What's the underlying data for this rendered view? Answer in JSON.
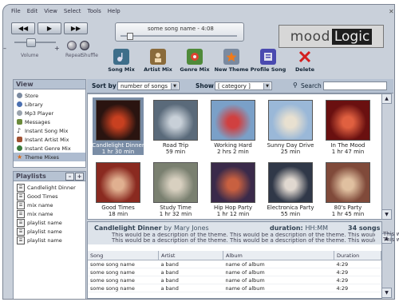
{
  "menu": [
    "File",
    "Edit",
    "View",
    "Select",
    "Tools",
    "Help"
  ],
  "transport": {
    "rewind": "◀◀",
    "play": "▶",
    "forward": "▶▶"
  },
  "volume": {
    "minus": "–",
    "plus": "+",
    "label": "Volume",
    "level": 0.35
  },
  "toggles": {
    "repeat": "Repeat",
    "shuffle": "Shuffle"
  },
  "now_playing": {
    "song": "some song name - 4:08"
  },
  "logo": {
    "part1": "mood",
    "part2": "Logic"
  },
  "toolbar": [
    {
      "label": "Song Mix",
      "icon": "song-mix-icon",
      "color": "#3e6e8a"
    },
    {
      "label": "Artist Mix",
      "icon": "artist-mix-icon",
      "color": "#8a6b3b"
    },
    {
      "label": "Genre Mix",
      "icon": "genre-mix-icon",
      "color": "#4f8a3a"
    },
    {
      "label": "New Theme",
      "icon": "star-icon",
      "color": "#d96a1a"
    },
    {
      "label": "Profile Song",
      "icon": "profile-song-icon",
      "color": "#4a4ab0"
    },
    {
      "label": "Delete",
      "icon": "delete-icon",
      "color": "#d41e1e"
    }
  ],
  "sort": {
    "label": "Sort by",
    "value": "number of songs"
  },
  "show": {
    "label": "Show",
    "value": "category"
  },
  "search": {
    "label": "Search",
    "value": ""
  },
  "view": {
    "title": "View",
    "items": [
      {
        "label": "Store",
        "color": "#7b8aa0"
      },
      {
        "label": "Library",
        "color": "#4a6fb0"
      },
      {
        "label": "Mp3 Player",
        "color": "#9aa3ad"
      },
      {
        "label": "Messages",
        "color": "#6a8a3a"
      },
      {
        "label": "Instant Song Mix",
        "color": "#333333"
      },
      {
        "label": "Instant Artist Mix",
        "color": "#a05030"
      },
      {
        "label": "Instant Genre Mix",
        "color": "#3a7a3a"
      },
      {
        "label": "Theme Mixes",
        "color": "#d96a1a"
      }
    ],
    "selected": 7
  },
  "playlists": {
    "title": "Playlists",
    "remove": "–",
    "add": "+",
    "items": [
      "Candlelight Dinner",
      "Good Times",
      "mix name",
      "mix name",
      "playlist name",
      "playlist name",
      "playlist name"
    ]
  },
  "themes": [
    {
      "name": "Candlelight Dinner",
      "duration": "1 hr 30 min",
      "bg": "#2a1410",
      "fg": "#c84020"
    },
    {
      "name": "Road Trip",
      "duration": "59 min",
      "bg": "#5a6a7a",
      "fg": "#c8d0d8"
    },
    {
      "name": "Working Hard",
      "duration": "2 hrs 2 min",
      "bg": "#7aa0c8",
      "fg": "#d04040"
    },
    {
      "name": "Sunny Day Drive",
      "duration": "25 min",
      "bg": "#9ab8d8",
      "fg": "#e8e0d0"
    },
    {
      "name": "In The Mood",
      "duration": "1 hr 47 min",
      "bg": "#6a1010",
      "fg": "#e06040"
    },
    {
      "name": "Good Times",
      "duration": "18 min",
      "bg": "#8a2a20",
      "fg": "#e0b090"
    },
    {
      "name": "Study Time",
      "duration": "1 hr 32 min",
      "bg": "#7a8070",
      "fg": "#d8d0c0"
    },
    {
      "name": "Hip Hop Party",
      "duration": "1 hr 12 min",
      "bg": "#3a2a4a",
      "fg": "#c86040"
    },
    {
      "name": "Electronica Party",
      "duration": "55 min",
      "bg": "#303848",
      "fg": "#e0d8d0"
    },
    {
      "name": "80's Party",
      "duration": "1 hr 45 min",
      "bg": "#804a3a",
      "fg": "#e0c0a0"
    }
  ],
  "selected_theme": 0,
  "detail": {
    "title": "Candlelight Dinner",
    "by": "by",
    "author": "Mary Jones",
    "duration_label": "duration:",
    "duration": "HH:MM",
    "song_count": "34 songs",
    "description_lines": [
      "This would be a description of the theme.  This would be a description of the theme.  This would be a description of the theme.",
      "This would be a description of the theme.  This would be a description of the theme.  This would be a description of the theme."
    ],
    "overflow_1": "This would",
    "overflow_2": "This would"
  },
  "songs": {
    "columns": [
      "Song",
      "Artist",
      "Album",
      "Duration"
    ],
    "rows": [
      [
        "some song name",
        "a band",
        "name of album",
        "4:29"
      ],
      [
        "some song name",
        "a band",
        "name of album",
        "4:29"
      ],
      [
        "some song name",
        "a band",
        "name of album",
        "4:29"
      ],
      [
        "some song name",
        "a band",
        "name of album",
        "4:29"
      ]
    ]
  }
}
